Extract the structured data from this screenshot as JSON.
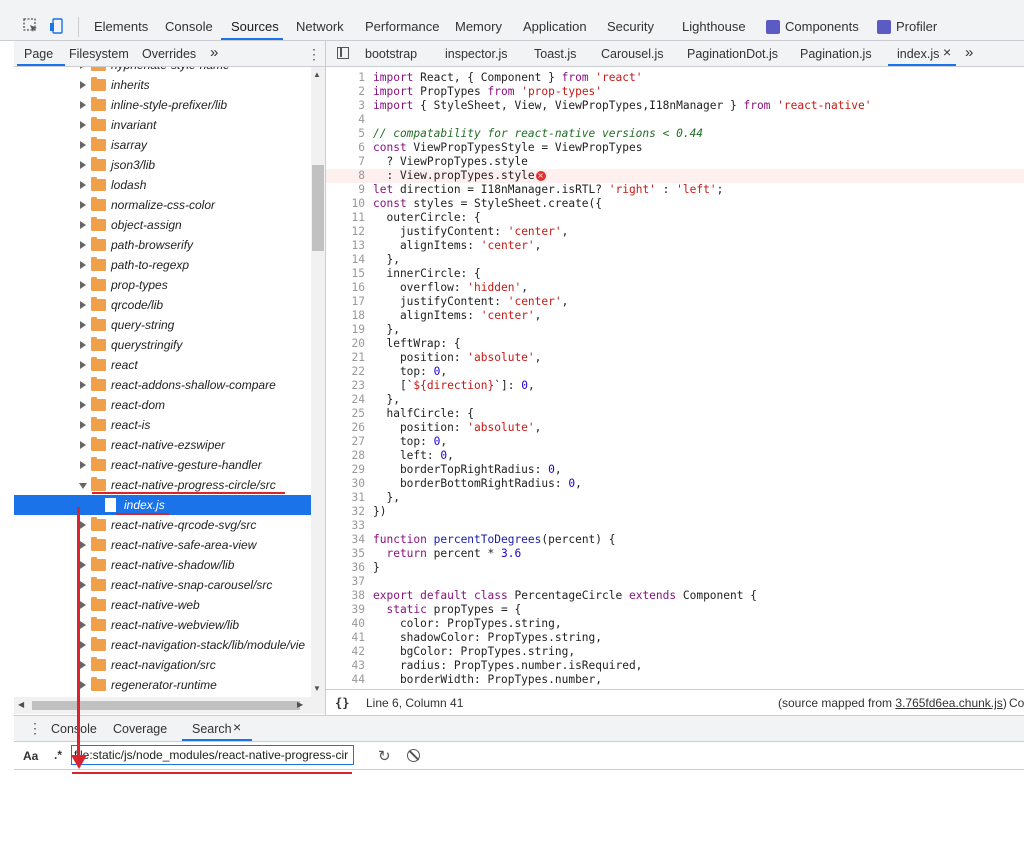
{
  "toolbar": {
    "tabs": [
      "Elements",
      "Console",
      "Sources",
      "Network",
      "Performance",
      "Memory",
      "Application",
      "Security",
      "Lighthouse",
      "Components",
      "Profiler"
    ],
    "active_tab": "Sources"
  },
  "navigator": {
    "tabs": [
      "Page",
      "Filesystem",
      "Overrides"
    ],
    "more": "»",
    "items": [
      {
        "label": "hyphenate-style-name",
        "type": "folder"
      },
      {
        "label": "inherits",
        "type": "folder"
      },
      {
        "label": "inline-style-prefixer/lib",
        "type": "folder"
      },
      {
        "label": "invariant",
        "type": "folder"
      },
      {
        "label": "isarray",
        "type": "folder"
      },
      {
        "label": "json3/lib",
        "type": "folder"
      },
      {
        "label": "lodash",
        "type": "folder"
      },
      {
        "label": "normalize-css-color",
        "type": "folder"
      },
      {
        "label": "object-assign",
        "type": "folder"
      },
      {
        "label": "path-browserify",
        "type": "folder"
      },
      {
        "label": "path-to-regexp",
        "type": "folder"
      },
      {
        "label": "prop-types",
        "type": "folder"
      },
      {
        "label": "qrcode/lib",
        "type": "folder"
      },
      {
        "label": "query-string",
        "type": "folder"
      },
      {
        "label": "querystringify",
        "type": "folder"
      },
      {
        "label": "react",
        "type": "folder"
      },
      {
        "label": "react-addons-shallow-compare",
        "type": "folder"
      },
      {
        "label": "react-dom",
        "type": "folder"
      },
      {
        "label": "react-is",
        "type": "folder"
      },
      {
        "label": "react-native-ezswiper",
        "type": "folder"
      },
      {
        "label": "react-native-gesture-handler",
        "type": "folder"
      },
      {
        "label": "react-native-progress-circle/src",
        "type": "folder-open"
      },
      {
        "label": "index.js",
        "type": "file-selected"
      },
      {
        "label": "react-native-qrcode-svg/src",
        "type": "folder"
      },
      {
        "label": "react-native-safe-area-view",
        "type": "folder"
      },
      {
        "label": "react-native-shadow/lib",
        "type": "folder"
      },
      {
        "label": "react-native-snap-carousel/src",
        "type": "folder"
      },
      {
        "label": "react-native-web",
        "type": "folder"
      },
      {
        "label": "react-native-webview/lib",
        "type": "folder"
      },
      {
        "label": "react-navigation-stack/lib/module/vie",
        "type": "folder"
      },
      {
        "label": "react-navigation/src",
        "type": "folder"
      },
      {
        "label": "regenerator-runtime",
        "type": "folder"
      }
    ]
  },
  "editor": {
    "tabs": [
      "bootstrap",
      "inspector.js",
      "Toast.js",
      "Carousel.js",
      "PaginationDot.js",
      "Pagination.js",
      "index.js"
    ],
    "active_tab": "index.js",
    "close": "×",
    "more": "»",
    "error_line": 8,
    "lines": [
      [
        [
          "k",
          "import "
        ],
        [
          "t",
          "React, { Component } "
        ],
        [
          "k",
          "from "
        ],
        [
          "s",
          "'react'"
        ]
      ],
      [
        [
          "k",
          "import "
        ],
        [
          "t",
          "PropTypes "
        ],
        [
          "k",
          "from "
        ],
        [
          "s",
          "'prop-types'"
        ]
      ],
      [
        [
          "k",
          "import "
        ],
        [
          "t",
          "{ StyleSheet, View, ViewPropTypes,I18nManager } "
        ],
        [
          "k",
          "from "
        ],
        [
          "s",
          "'react-native'"
        ]
      ],
      [],
      [
        [
          "c",
          "// compatability for react-native versions < 0.44"
        ]
      ],
      [
        [
          "k",
          "const "
        ],
        [
          "t",
          "ViewPropTypesStyle = ViewPropTypes"
        ]
      ],
      [
        [
          "t",
          "  ? ViewPropTypes.style"
        ]
      ],
      [
        [
          "t",
          "  : View.propTypes.style"
        ]
      ],
      [
        [
          "k",
          "let "
        ],
        [
          "t",
          "direction = I18nManager.isRTL? "
        ],
        [
          "s",
          "'right'"
        ],
        [
          "t",
          " : "
        ],
        [
          "s",
          "'left'"
        ],
        [
          "t",
          ";"
        ]
      ],
      [
        [
          "k",
          "const "
        ],
        [
          "t",
          "styles = StyleSheet.create({"
        ]
      ],
      [
        [
          "t",
          "  outerCircle: {"
        ]
      ],
      [
        [
          "t",
          "    justifyContent: "
        ],
        [
          "s",
          "'center'"
        ],
        [
          "t",
          ","
        ]
      ],
      [
        [
          "t",
          "    alignItems: "
        ],
        [
          "s",
          "'center'"
        ],
        [
          "t",
          ","
        ]
      ],
      [
        [
          "t",
          "  },"
        ]
      ],
      [
        [
          "t",
          "  innerCircle: {"
        ]
      ],
      [
        [
          "t",
          "    overflow: "
        ],
        [
          "s",
          "'hidden'"
        ],
        [
          "t",
          ","
        ]
      ],
      [
        [
          "t",
          "    justifyContent: "
        ],
        [
          "s",
          "'center'"
        ],
        [
          "t",
          ","
        ]
      ],
      [
        [
          "t",
          "    alignItems: "
        ],
        [
          "s",
          "'center'"
        ],
        [
          "t",
          ","
        ]
      ],
      [
        [
          "t",
          "  },"
        ]
      ],
      [
        [
          "t",
          "  leftWrap: {"
        ]
      ],
      [
        [
          "t",
          "    position: "
        ],
        [
          "s",
          "'absolute'"
        ],
        [
          "t",
          ","
        ]
      ],
      [
        [
          "t",
          "    top: "
        ],
        [
          "n",
          "0"
        ],
        [
          "t",
          ","
        ]
      ],
      [
        [
          "t",
          "    [`"
        ],
        [
          "s",
          "${direction}"
        ],
        [
          "t",
          "`]: "
        ],
        [
          "n",
          "0"
        ],
        [
          "t",
          ","
        ]
      ],
      [
        [
          "t",
          "  },"
        ]
      ],
      [
        [
          "t",
          "  halfCircle: {"
        ]
      ],
      [
        [
          "t",
          "    position: "
        ],
        [
          "s",
          "'absolute'"
        ],
        [
          "t",
          ","
        ]
      ],
      [
        [
          "t",
          "    top: "
        ],
        [
          "n",
          "0"
        ],
        [
          "t",
          ","
        ]
      ],
      [
        [
          "t",
          "    left: "
        ],
        [
          "n",
          "0"
        ],
        [
          "t",
          ","
        ]
      ],
      [
        [
          "t",
          "    borderTopRightRadius: "
        ],
        [
          "n",
          "0"
        ],
        [
          "t",
          ","
        ]
      ],
      [
        [
          "t",
          "    borderBottomRightRadius: "
        ],
        [
          "n",
          "0"
        ],
        [
          "t",
          ","
        ]
      ],
      [
        [
          "t",
          "  },"
        ]
      ],
      [
        [
          "t",
          "})"
        ]
      ],
      [],
      [
        [
          "k",
          "function "
        ],
        [
          "f",
          "percentToDegrees"
        ],
        [
          "t",
          "(percent) {"
        ]
      ],
      [
        [
          "k",
          "  return "
        ],
        [
          "t",
          "percent * "
        ],
        [
          "n",
          "3.6"
        ]
      ],
      [
        [
          "t",
          "}"
        ]
      ],
      [],
      [
        [
          "k",
          "export default class "
        ],
        [
          "t",
          "PercentageCircle "
        ],
        [
          "k",
          "extends "
        ],
        [
          "t",
          "Component {"
        ]
      ],
      [
        [
          "k",
          "  static "
        ],
        [
          "t",
          "propTypes = {"
        ]
      ],
      [
        [
          "t",
          "    color: PropTypes.string,"
        ]
      ],
      [
        [
          "t",
          "    shadowColor: PropTypes.string,"
        ]
      ],
      [
        [
          "t",
          "    bgColor: PropTypes.string,"
        ]
      ],
      [
        [
          "t",
          "    radius: PropTypes.number.isRequired,"
        ]
      ],
      [
        [
          "t",
          "    borderWidth: PropTypes.number,"
        ]
      ]
    ]
  },
  "status": {
    "format_icon": "{}",
    "position": "Line 6, Column 41",
    "source_prefix": "(source mapped from ",
    "source_link": "3.765fd6ea.chunk.js",
    "source_suffix": ")",
    "trail": "Cov"
  },
  "drawer": {
    "tabs": [
      "Console",
      "Coverage",
      "Search"
    ],
    "active_tab": "Search",
    "close": "×",
    "case_toggle": "Aa",
    "regex_toggle": ".*",
    "search_value": "file:static/js/node_modules/react-native-progress-cir"
  },
  "colors": {
    "accent": "#1a73e8",
    "annotation": "#d9232e",
    "folder": "#f0a04b"
  }
}
